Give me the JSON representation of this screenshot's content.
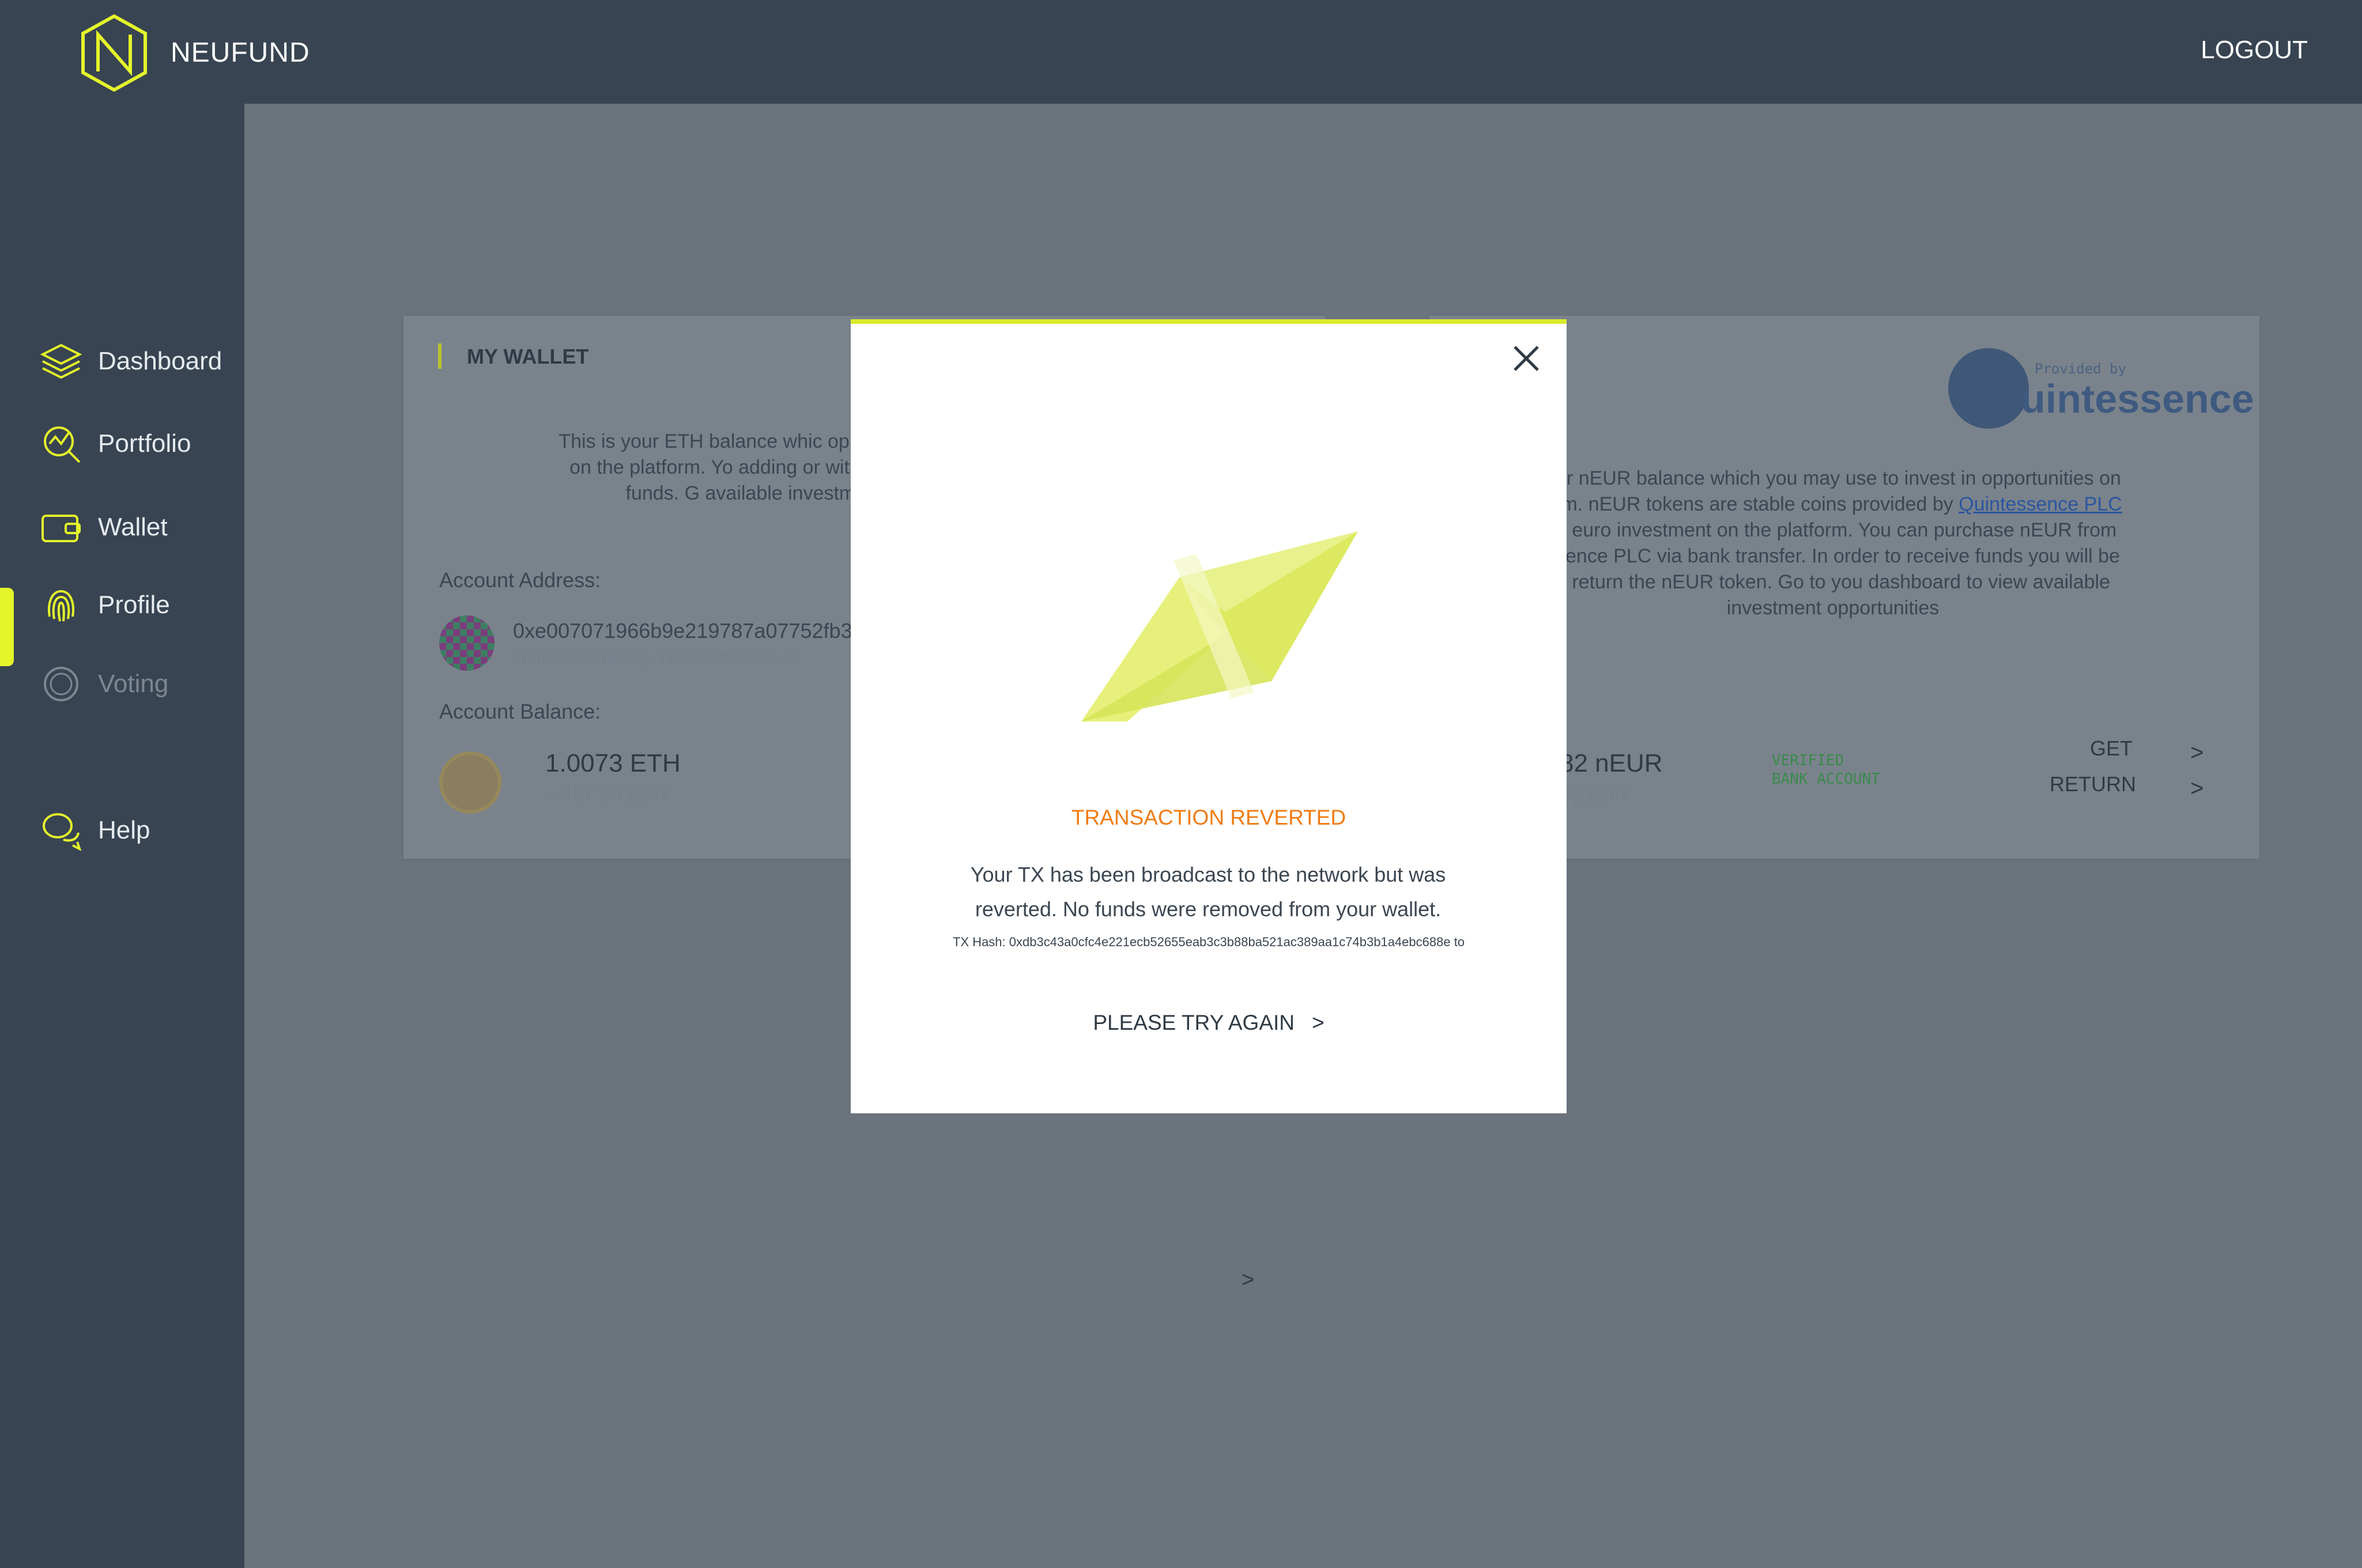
{
  "app": {
    "brand": "NEUFUND",
    "logout_label": "LOGOUT"
  },
  "sidebar": {
    "items": [
      {
        "label": "Dashboard",
        "icon": "layers-icon"
      },
      {
        "label": "Portfolio",
        "icon": "portfolio-chart-icon"
      },
      {
        "label": "Wallet",
        "icon": "wallet-icon"
      },
      {
        "label": "Profile",
        "icon": "fingerprint-icon"
      },
      {
        "label": "Voting",
        "icon": "vote-icon"
      },
      {
        "label": "Help",
        "icon": "chat-bubbles-icon"
      }
    ],
    "active": "Wallet",
    "accent": "#e4f52a"
  },
  "wallet_card": {
    "title": "MY WALLET",
    "description": "This is your ETH balance whic opportunities on the platform. Yo adding or withdrawing funds. G available investmer",
    "account_address_label": "Account Address:",
    "address": "0xe007071966b9e219787a07752fb3",
    "tx_history": "Transaction History: https://etherscan.io",
    "balance_label": "Account Balance:",
    "eth_balance": "1.0073 ETH",
    "eth_eur": "≈ 487.50 EUR"
  },
  "euro_card": {
    "provider_text": "Provided by",
    "provider_name": "uintessence",
    "description_1": "our nEUR balance which you may use to invest in opportunities on",
    "description_2": "orm. nEUR tokens are stable coins provided by",
    "provider_link": "Quintessence PLC",
    "description_3": "or euro investment on the platform. You can purchase nEUR from",
    "description_4": "ssence PLC via bank transfer. In order to receive funds you will be",
    "description_5": "o return the nEUR token.  Go to you dashboard to view available",
    "description_6": "investment opportunities",
    "neur_balance": "82 nEUR",
    "neur_eur": "82 EUR",
    "verified_1": "VERIFIED",
    "verified_2": "BANK ACCOUNT",
    "get_label": "GET",
    "return_label": "RETURN"
  },
  "modal": {
    "title": "TRANSACTION REVERTED",
    "message_1": "Your TX has been broadcast to the network but was",
    "message_2": "reverted. No funds were removed from your wallet.",
    "tx_hash": "TX Hash: 0xdb3c43a0cfc4e221ecb52655eab3c3b88ba521ac389aa1c74b3b1a4ebc688e to",
    "retry_label": "PLEASE TRY AGAIN",
    "accent": "#f07b12"
  }
}
